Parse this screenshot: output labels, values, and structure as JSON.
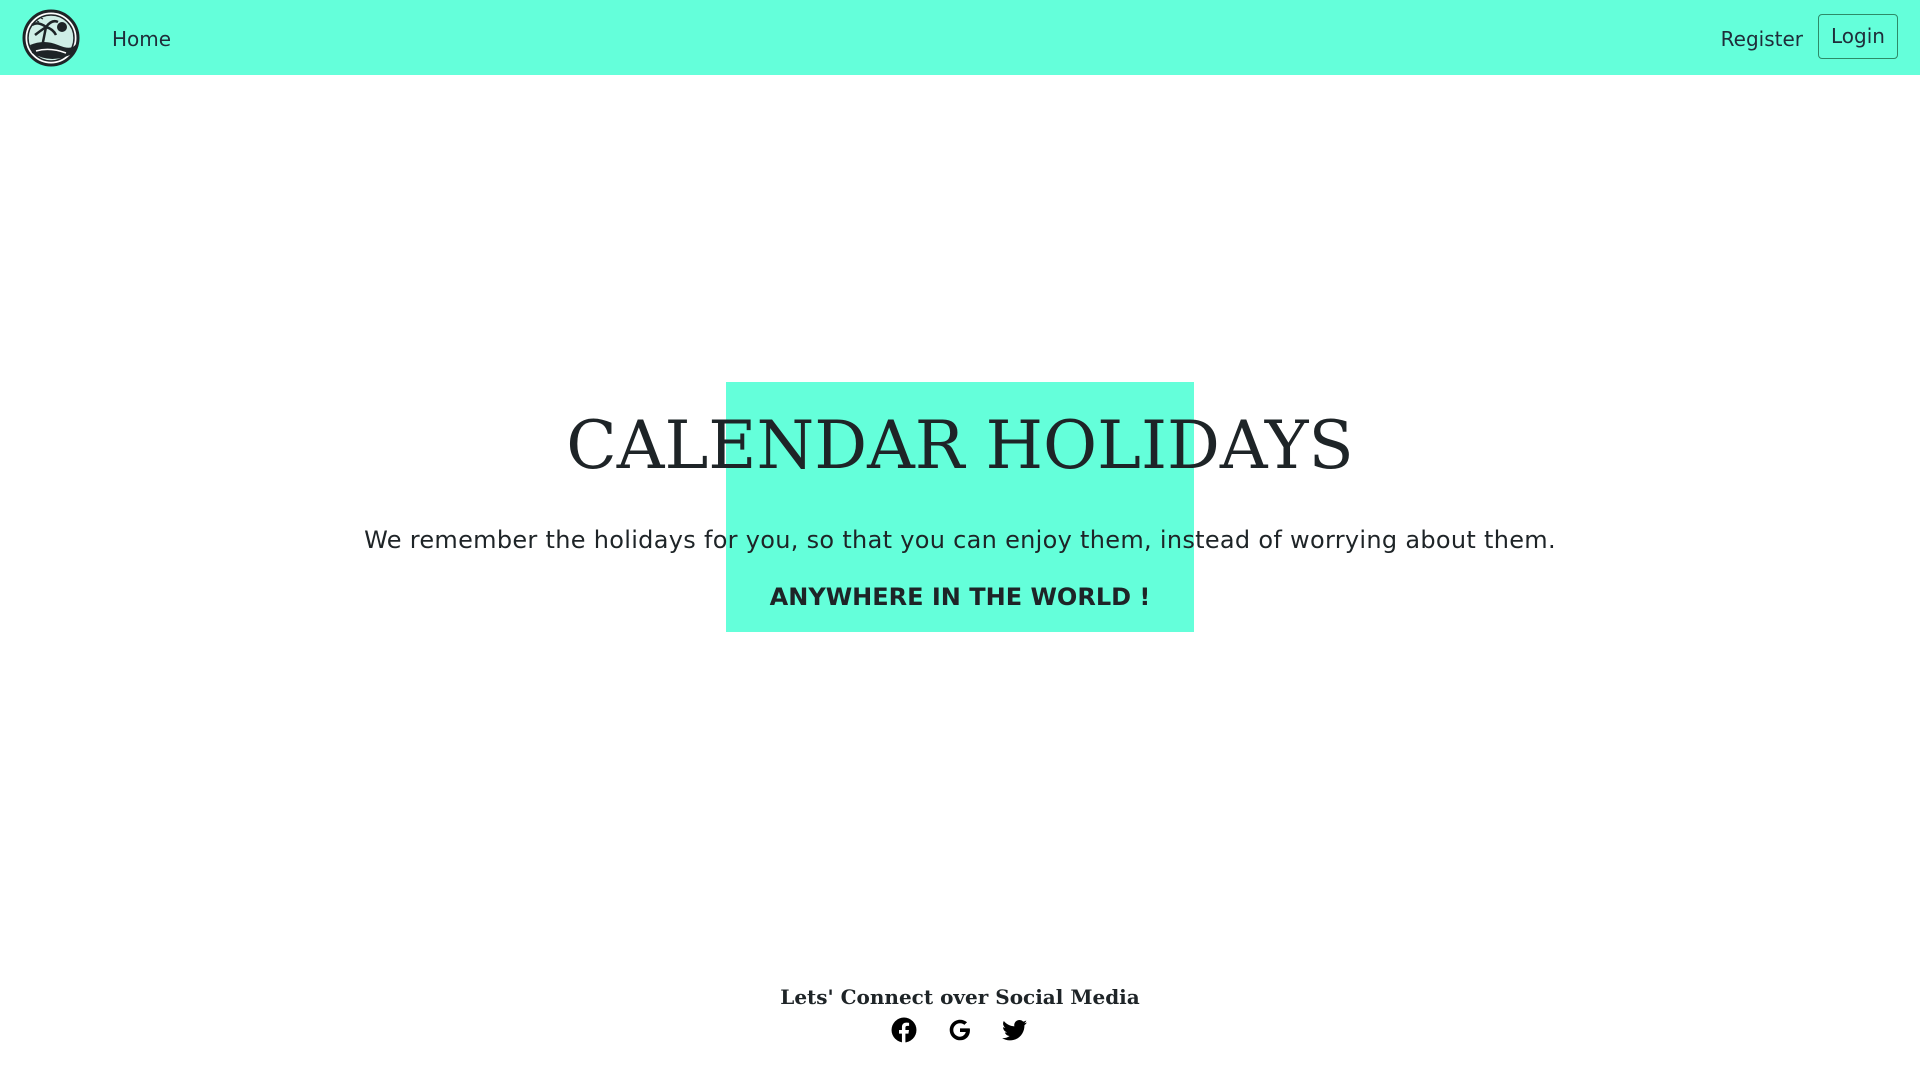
{
  "navbar": {
    "logo_icon": "palm-island-logo-icon",
    "home_label": "Home",
    "register_label": "Register",
    "login_label": "Login",
    "background_color": "#64ffda"
  },
  "hero": {
    "title": "CALENDAR HOLIDAYS",
    "subtitle": "We remember the holidays for you, so that you can enjoy them, instead of worrying about them.",
    "tagline": "ANYWHERE IN THE WORLD !",
    "accent_color": "#64ffda"
  },
  "footer": {
    "heading": "Lets' Connect over Social Media",
    "social_icons": [
      "facebook-icon",
      "google-icon",
      "twitter-icon"
    ]
  }
}
